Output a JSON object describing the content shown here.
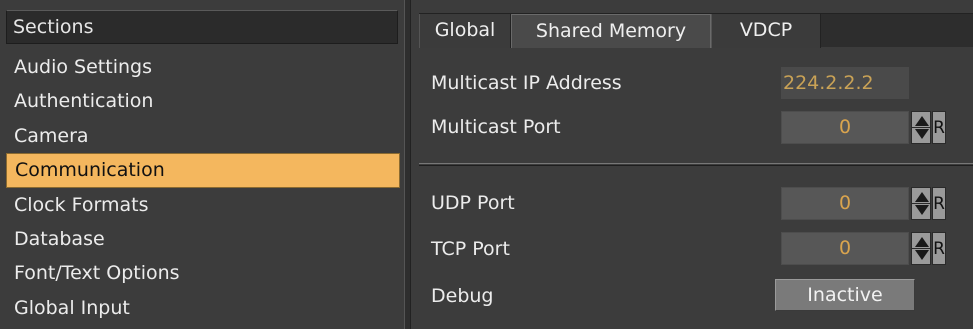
{
  "sections": {
    "header": "Sections",
    "items": [
      {
        "label": "Audio Settings"
      },
      {
        "label": "Authentication"
      },
      {
        "label": "Camera"
      },
      {
        "label": "Communication",
        "selected": true
      },
      {
        "label": "Clock Formats"
      },
      {
        "label": "Database"
      },
      {
        "label": "Font/Text Options"
      },
      {
        "label": "Global Input"
      }
    ]
  },
  "tabs": [
    {
      "label": "Global"
    },
    {
      "label": "Shared Memory",
      "active": true
    },
    {
      "label": "VDCP"
    }
  ],
  "fields": {
    "multicast_ip": {
      "label": "Multicast IP Address",
      "value": "224.2.2.2"
    },
    "multicast_port": {
      "label": "Multicast Port",
      "value": "0"
    },
    "udp_port": {
      "label": "UDP Port",
      "value": "0"
    },
    "tcp_port": {
      "label": "TCP Port",
      "value": "0"
    },
    "debug": {
      "label": "Debug",
      "value": "Inactive"
    }
  },
  "reset_label": "R",
  "colors": {
    "accent": "#f4b75e",
    "value_text": "#d9a44e",
    "panel_bg": "#3c3c3c"
  }
}
